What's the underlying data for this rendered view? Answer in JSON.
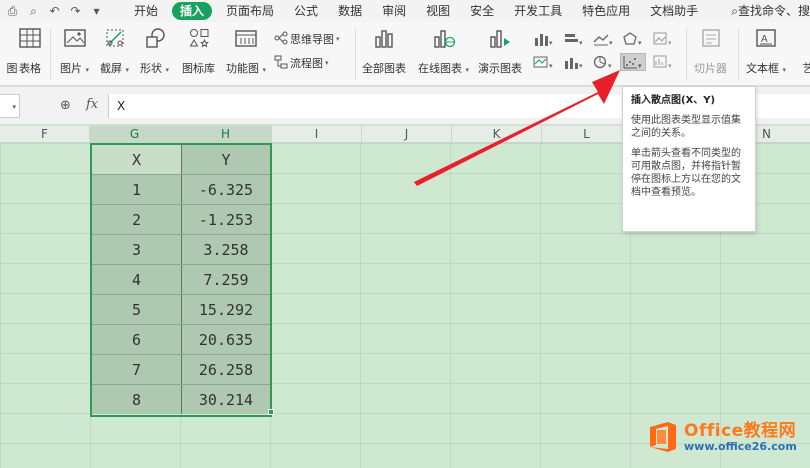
{
  "menubar": {
    "quick_access": [
      "print-icon",
      "preview-icon",
      "undo-icon",
      "redo-icon",
      "more-icon"
    ],
    "tabs": [
      "开始",
      "插入",
      "页面布局",
      "公式",
      "数据",
      "审阅",
      "视图",
      "安全",
      "开发工具",
      "特色应用",
      "文档助手"
    ],
    "active_tab": "插入",
    "search": "查找命令、搜"
  },
  "ribbon": {
    "left_cut": "图",
    "table": "表格",
    "picture": "图片",
    "screenshot": "截屏",
    "shape": "形状",
    "icon_library": "图标库",
    "function_chart": "功能图",
    "mindmap": "思维导图",
    "flowchart": "流程图",
    "all_charts": "全部图表",
    "online_charts": "在线图表",
    "demo_charts": "演示图表",
    "slicer": "切片器",
    "textbox": "文本框",
    "art": "艺"
  },
  "formula_bar": {
    "fx": "fx",
    "content": "X"
  },
  "columns": [
    "F",
    "G",
    "H",
    "I",
    "J",
    "K",
    "L",
    "M",
    "N"
  ],
  "table": {
    "headers": [
      "X",
      "Y"
    ],
    "rows": [
      [
        "1",
        "-6.325"
      ],
      [
        "2",
        "-1.253"
      ],
      [
        "3",
        "3.258"
      ],
      [
        "4",
        "7.259"
      ],
      [
        "5",
        "15.292"
      ],
      [
        "6",
        "20.635"
      ],
      [
        "7",
        "26.258"
      ],
      [
        "8",
        "30.214"
      ]
    ]
  },
  "tooltip": {
    "title": "插入散点图(X、Y)",
    "p1": "使用此图表类型显示值集之间的关系。",
    "p2": "单击箭头查看不同类型的可用散点图，并将指针暂停在图标上方以在您的文档中查看预览。"
  },
  "watermark": {
    "line1": "Office教程网",
    "line2": "www.office26.com"
  },
  "colors": {
    "accent": "#19a15f",
    "arrow": "#e8202a",
    "selection": "#2f9a52"
  }
}
